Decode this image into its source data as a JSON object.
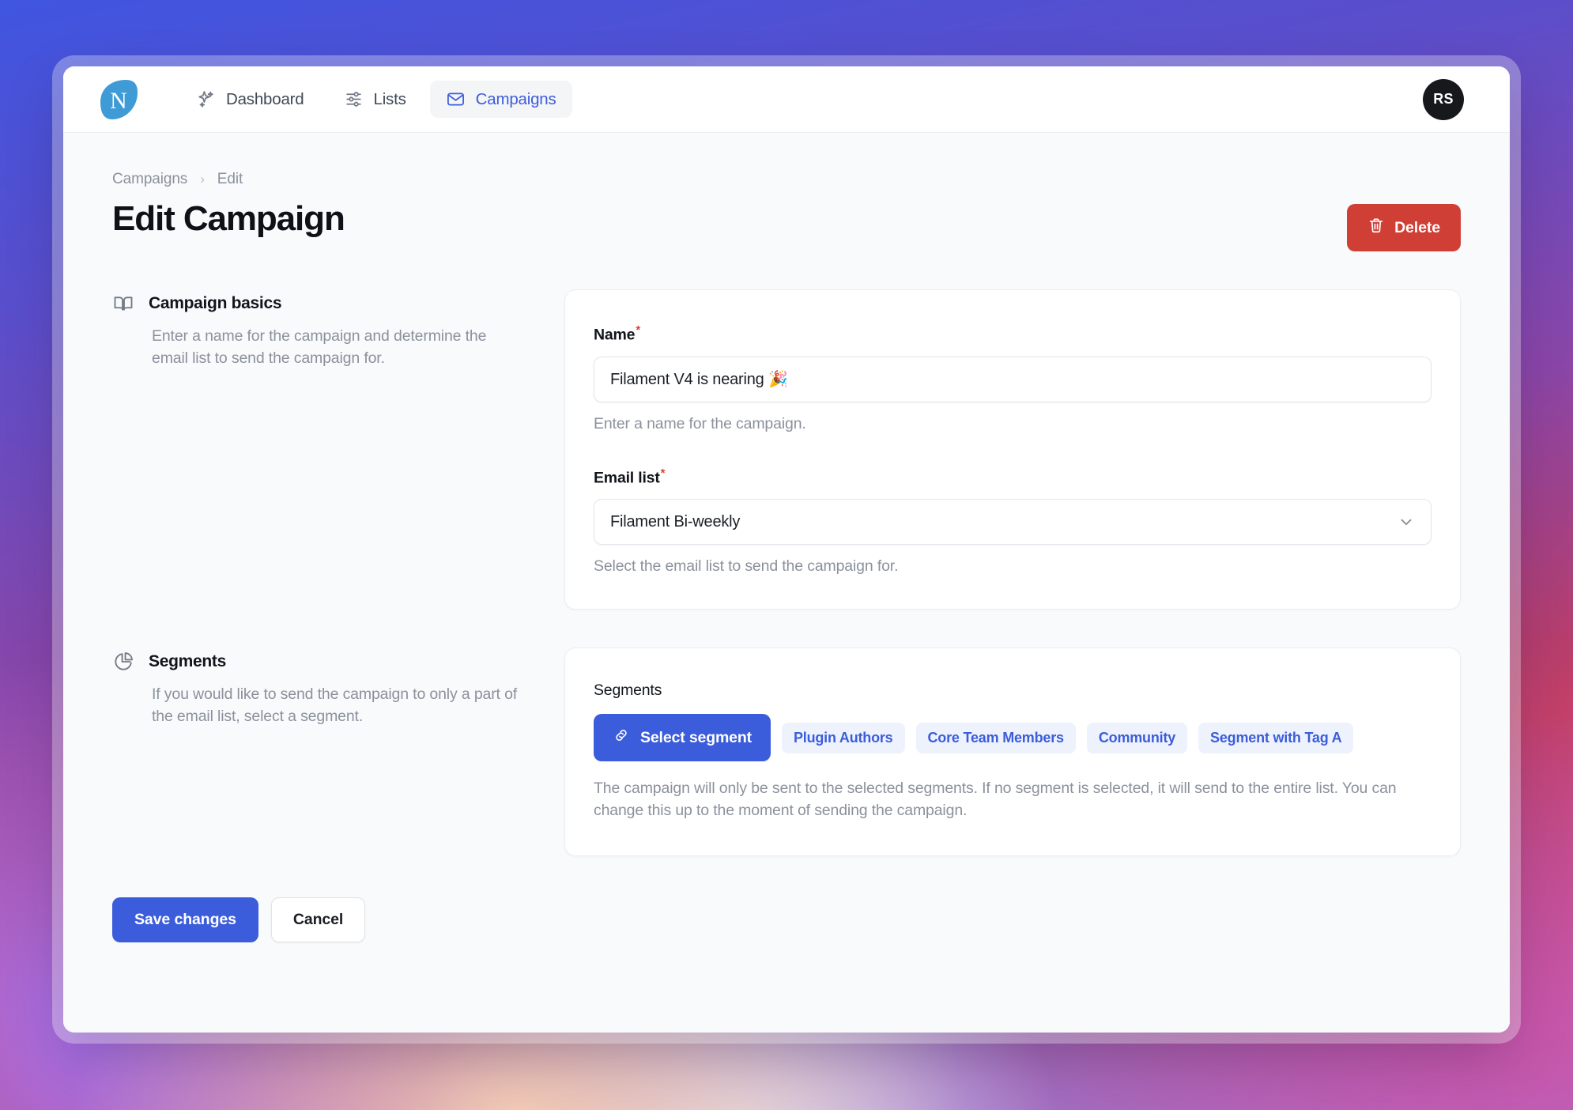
{
  "topbar": {
    "logo_icon": "leaf-logo-icon",
    "logo_letter": "N",
    "nav": [
      {
        "label": "Dashboard",
        "icon": "sparkles-icon",
        "active": false
      },
      {
        "label": "Lists",
        "icon": "sliders-icon",
        "active": false
      },
      {
        "label": "Campaigns",
        "icon": "envelope-icon",
        "active": true
      }
    ],
    "avatar_initials": "RS"
  },
  "breadcrumb": {
    "parent": "Campaigns",
    "separator": "›",
    "current": "Edit"
  },
  "header": {
    "title": "Edit Campaign",
    "delete_label": "Delete",
    "delete_icon": "trash-icon"
  },
  "sections": {
    "basics": {
      "icon": "open-book-icon",
      "title": "Campaign basics",
      "description": "Enter a name for the campaign and determine the email list to send the campaign for.",
      "name_field": {
        "label": "Name",
        "required_marker": "*",
        "value": "Filament V4 is nearing 🎉",
        "placeholder": "Campaign name",
        "help": "Enter a name for the campaign."
      },
      "email_list_field": {
        "label": "Email list",
        "required_marker": "*",
        "value": "Filament Bi-weekly",
        "help": "Select the email list to send the campaign for.",
        "chevron_icon": "chevron-down-icon",
        "options": [
          "Filament Bi-weekly"
        ]
      }
    },
    "segments": {
      "icon": "pie-chart-icon",
      "title": "Segments",
      "description": "If you would like to send the campaign to only a part of the email list, select a segment.",
      "card_label": "Segments",
      "select_button": {
        "label": "Select segment",
        "icon": "link-icon"
      },
      "tags": [
        "Plugin Authors",
        "Core Team Members",
        "Community",
        "Segment with Tag A"
      ],
      "help": "The campaign will only be sent to the selected segments. If no segment is selected, it will send to the entire list. You can change this up to the moment of sending the campaign."
    }
  },
  "footer": {
    "save_label": "Save changes",
    "cancel_label": "Cancel"
  },
  "colors": {
    "primary": "#3c5ddb",
    "danger": "#d03f36",
    "tag_bg": "#eef2fd",
    "tag_text": "#3c5ddb",
    "logo": "#3f9bd6",
    "avatar_bg": "#17181b"
  }
}
